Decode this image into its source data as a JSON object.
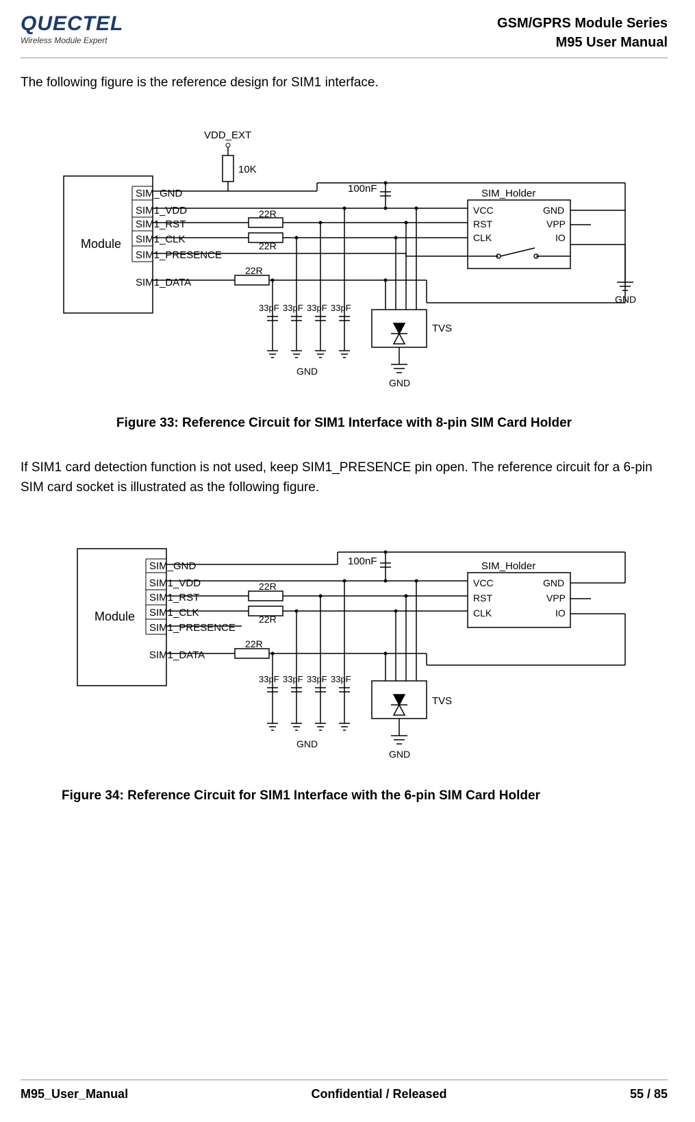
{
  "header": {
    "logo_main": "QUECTEL",
    "logo_sub": "Wireless Module Expert",
    "series": "GSM/GPRS Module Series",
    "manual": "M95 User Manual"
  },
  "intro1": "The following figure is the reference design for SIM1 interface.",
  "figure33": {
    "vdd_ext": "VDD_EXT",
    "r10k": "10K",
    "sim_gnd": "SIM_GND",
    "sim1_vdd": "SIM1_VDD",
    "sim1_rst": "SIM1_RST",
    "sim1_clk": "SIM1_CLK",
    "sim1_presence": "SIM1_PRESENCE",
    "sim1_data": "SIM1_DATA",
    "module": "Module",
    "r22_1": "22R",
    "r22_2": "22R",
    "r22_3": "22R",
    "c100n": "100nF",
    "holder": "SIM_Holder",
    "vcc": "VCC",
    "rst": "RST",
    "clk": "CLK",
    "gnd_r": "GND",
    "vpp": "VPP",
    "io": "IO",
    "gnd_sym": "GND",
    "c33_1": "33pF",
    "c33_2": "33pF",
    "c33_3": "33pF",
    "c33_4": "33pF",
    "tvs": "TVS",
    "gnd_b1": "GND",
    "gnd_b2": "GND",
    "caption": "Figure 33: Reference Circuit for SIM1 Interface with 8-pin SIM Card Holder"
  },
  "intro2": "If SIM1 card detection function is not used, keep SIM1_PRESENCE pin open. The reference circuit for a 6-pin SIM card socket is illustrated as the following figure.",
  "figure34": {
    "sim_gnd": "SIM_GND",
    "sim1_vdd": "SIM1_VDD",
    "sim1_rst": "SIM1_RST",
    "sim1_clk": "SIM1_CLK",
    "sim1_presence": "SIM1_PRESENCE",
    "sim1_data": "SIM1_DATA",
    "module": "Module",
    "r22_1": "22R",
    "r22_2": "22R",
    "r22_3": "22R",
    "c100n": "100nF",
    "holder": "SIM_Holder",
    "vcc": "VCC",
    "rst": "RST",
    "clk": "CLK",
    "gnd_r": "GND",
    "vpp": "VPP",
    "io": "IO",
    "c33_1": "33pF",
    "c33_2": "33pF",
    "c33_3": "33pF",
    "c33_4": "33pF",
    "tvs": "TVS",
    "gnd_b1": "GND",
    "gnd_b2": "GND",
    "caption": "Figure 34: Reference Circuit for SIM1 Interface with the 6-pin SIM Card Holder"
  },
  "footer": {
    "left": "M95_User_Manual",
    "mid": "Confidential / Released",
    "right": "55 / 85"
  }
}
